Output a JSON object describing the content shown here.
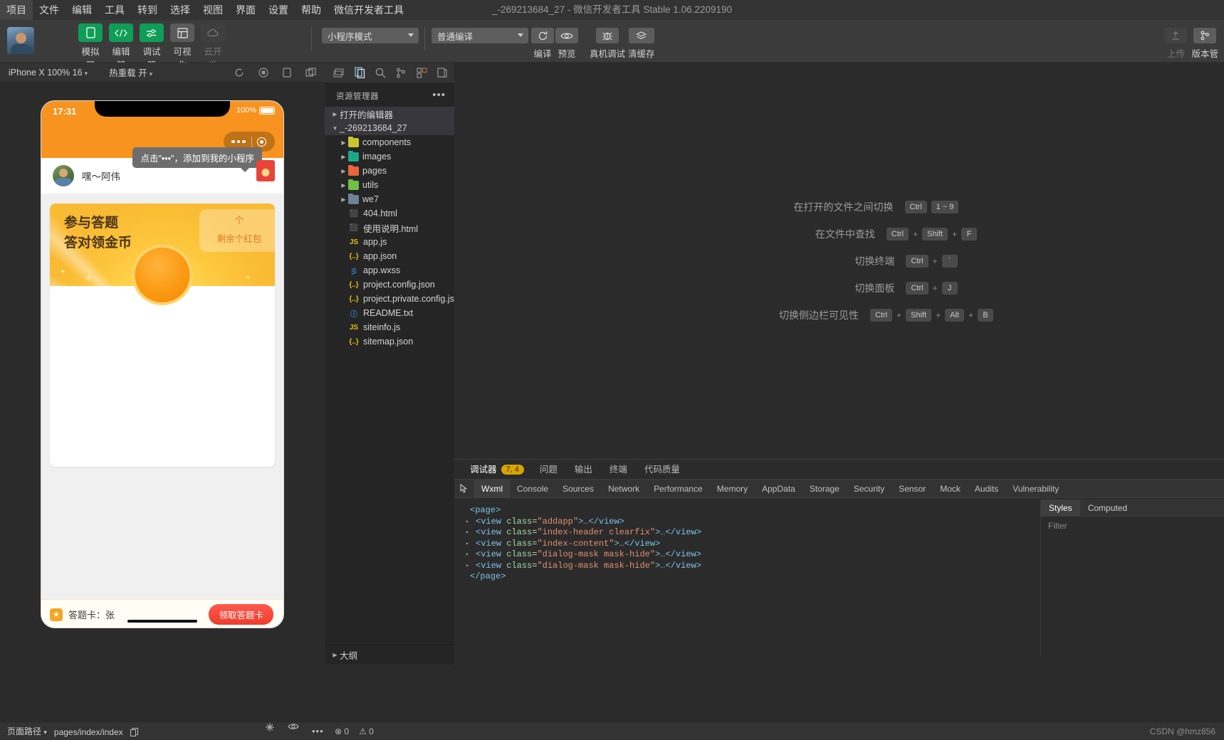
{
  "window": {
    "title": "_-269213684_27 - 微信开发者工具 Stable 1.06.2209190"
  },
  "menu": {
    "items": [
      "项目",
      "文件",
      "编辑",
      "工具",
      "转到",
      "选择",
      "视图",
      "界面",
      "设置",
      "帮助",
      "微信开发者工具"
    ]
  },
  "toolbar": {
    "modes": [
      {
        "label": "模拟器",
        "icon": "phone-icon",
        "state": "active"
      },
      {
        "label": "编辑器",
        "icon": "code-icon",
        "state": "active"
      },
      {
        "label": "调试器",
        "icon": "sliders-icon",
        "state": "active"
      },
      {
        "label": "可视化",
        "icon": "layout-icon",
        "state": "gray"
      },
      {
        "label": "云开发",
        "icon": "cloud-icon",
        "state": "disabled"
      }
    ],
    "mode_select": "小程序模式",
    "compile_select": "普通编译",
    "actions": [
      {
        "label": "编译",
        "icon": "refresh-icon"
      },
      {
        "label": "预览",
        "icon": "eye-icon"
      },
      {
        "label": "真机调试",
        "icon": "bug-icon"
      },
      {
        "label": "清缓存",
        "icon": "layers-icon"
      }
    ],
    "right_actions": [
      {
        "label": "上传",
        "icon": "upload-icon",
        "state": "disabled"
      },
      {
        "label": "版本管",
        "icon": "branch-icon",
        "state": "normal"
      }
    ]
  },
  "simulator": {
    "device_select": "iPhone X 100% 16",
    "hotreload_select": "热重载 开",
    "icons": [
      "refresh-icon",
      "record-icon",
      "rotate-icon",
      "split-icon"
    ],
    "phone": {
      "time": "17:31",
      "battery": "100%",
      "user_name": "嘿～阿伟",
      "tooltip": "点击\"•••\"，添加到我的小程序",
      "banner_title_line1": "参与答题",
      "banner_title_line2": "答对领金币",
      "banner_count": "个",
      "banner_count_label": "剩余个红包",
      "footer_label": "答题卡：张",
      "footer_button": "领取答题卡"
    }
  },
  "explorer": {
    "title": "资源管理器",
    "more": "•••",
    "open_editors": "打开的编辑器",
    "project": "_-269213684_27",
    "folders": [
      {
        "name": "components",
        "color": "#c9c430"
      },
      {
        "name": "images",
        "color": "#19a888"
      },
      {
        "name": "pages",
        "color": "#e8663d"
      },
      {
        "name": "utils",
        "color": "#6fbf44"
      },
      {
        "name": "we7",
        "color": "#6d8294"
      }
    ],
    "files": [
      {
        "name": "404.html",
        "icon": "html-icon",
        "glyph": "5",
        "color": "#e44d26"
      },
      {
        "name": "使用说明.html",
        "icon": "html-icon",
        "glyph": "5",
        "color": "#e44d26"
      },
      {
        "name": "app.js",
        "icon": "js-icon",
        "glyph": "JS",
        "color": "#e5c107"
      },
      {
        "name": "app.json",
        "icon": "json-icon",
        "glyph": "{..}",
        "color": "#e5c107"
      },
      {
        "name": "app.wxss",
        "icon": "css-icon",
        "glyph": "3",
        "color": "#2d8fd5"
      },
      {
        "name": "project.config.json",
        "icon": "json-icon",
        "glyph": "{..}",
        "color": "#e5c107"
      },
      {
        "name": "project.private.config.js...",
        "icon": "json-icon",
        "glyph": "{..}",
        "color": "#e5c107"
      },
      {
        "name": "README.txt",
        "icon": "info-icon",
        "glyph": "i",
        "color": "#2d8fd5"
      },
      {
        "name": "siteinfo.js",
        "icon": "js-icon",
        "glyph": "JS",
        "color": "#e5c107"
      },
      {
        "name": "sitemap.json",
        "icon": "json-icon",
        "glyph": "{..}",
        "color": "#e5c107"
      }
    ],
    "outline": "大纲"
  },
  "editor_welcome": {
    "shortcuts": [
      {
        "desc": "在打开的文件之间切换",
        "keys": [
          "Ctrl",
          "1 ~ 9"
        ],
        "seps": [
          ""
        ]
      },
      {
        "desc": "在文件中查找",
        "keys": [
          "Ctrl",
          "Shift",
          "F"
        ],
        "seps": [
          "+",
          "+"
        ]
      },
      {
        "desc": "切换终端",
        "keys": [
          "Ctrl",
          "`"
        ],
        "seps": [
          "+"
        ]
      },
      {
        "desc": "切换面板",
        "keys": [
          "Ctrl",
          "J"
        ],
        "seps": [
          "+"
        ]
      },
      {
        "desc": "切换侧边栏可见性",
        "keys": [
          "Ctrl",
          "Shift",
          "Alt",
          "B"
        ],
        "seps": [
          "+",
          "+",
          "+"
        ]
      }
    ]
  },
  "devtools": {
    "panel_tabs": [
      {
        "label": "调试器",
        "badge": "7, 4",
        "active": true
      },
      {
        "label": "问题",
        "badge": "",
        "active": false
      },
      {
        "label": "输出",
        "badge": "",
        "active": false
      },
      {
        "label": "终端",
        "badge": "",
        "active": false
      },
      {
        "label": "代码质量",
        "badge": "",
        "active": false
      }
    ],
    "inspect_icon": "inspect-icon",
    "tabs": [
      "Wxml",
      "Console",
      "Sources",
      "Network",
      "Performance",
      "Memory",
      "AppData",
      "Storage",
      "Security",
      "Sensor",
      "Mock",
      "Audits",
      "Vulnerability"
    ],
    "active_tab": "Wxml",
    "wxml": [
      {
        "indent": 0,
        "arrow": "",
        "text": "<page>",
        "kind": "tag"
      },
      {
        "indent": 1,
        "arrow": "▸",
        "cls": "addapp"
      },
      {
        "indent": 1,
        "arrow": "▸",
        "cls": "index-header clearfix"
      },
      {
        "indent": 1,
        "arrow": "▸",
        "cls": "index-content"
      },
      {
        "indent": 1,
        "arrow": "▸",
        "cls": "dialog-mask mask-hide"
      },
      {
        "indent": 1,
        "arrow": "▸",
        "cls": "dialog-mask mask-hide"
      },
      {
        "indent": 0,
        "arrow": "",
        "text": "</page>",
        "kind": "tag"
      }
    ],
    "styles_tabs": [
      "Styles",
      "Computed"
    ],
    "styles_active": "Styles",
    "filter_placeholder": "Filter"
  },
  "status": {
    "page_path_label": "页面路径",
    "page_path": "pages/index/index",
    "errors": "0",
    "warnings": "0",
    "watermark": "CSDN @hmz856"
  }
}
